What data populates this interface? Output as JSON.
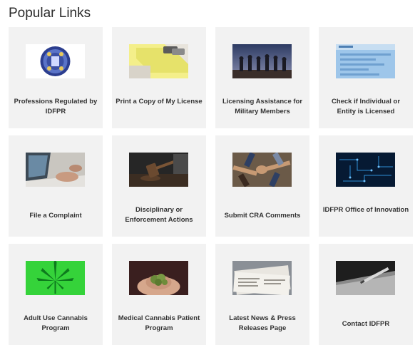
{
  "page": {
    "title": "Popular Links"
  },
  "links": [
    {
      "label": "Professions Regulated by IDFPR",
      "icon": "idfpr-seal-icon"
    },
    {
      "label": "Print a Copy of My License",
      "icon": "license-card-icon"
    },
    {
      "label": "Licensing Assistance for Military Members",
      "icon": "military-silhouettes-icon"
    },
    {
      "label": "Check if Individual or Entity is Licensed",
      "icon": "license-lookup-screen-icon"
    },
    {
      "label": "File a Complaint",
      "icon": "laptop-typing-icon"
    },
    {
      "label": "Disciplinary or Enforcement Actions",
      "icon": "gavel-icon"
    },
    {
      "label": "Submit CRA Comments",
      "icon": "team-hands-icon"
    },
    {
      "label": "IDFPR Office of Innovation",
      "icon": "digital-circuit-icon"
    },
    {
      "label": "Adult Use Cannabis Program",
      "icon": "cannabis-leaf-icon"
    },
    {
      "label": "Medical Cannabis Patient Program",
      "icon": "cannabis-in-hands-icon"
    },
    {
      "label": "Latest News & Press Releases Page",
      "icon": "newspapers-icon"
    },
    {
      "label": "Contact IDFPR",
      "icon": "pen-paper-icon"
    }
  ]
}
